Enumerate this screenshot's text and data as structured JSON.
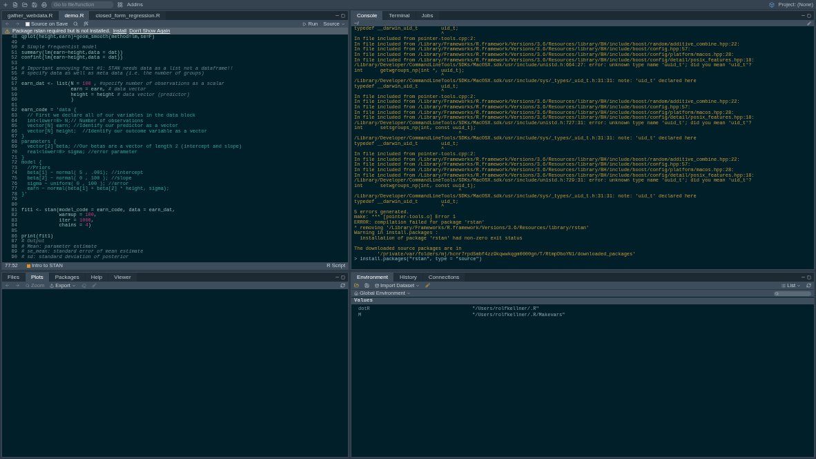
{
  "toolbar": {
    "goto_placeholder": "Go to file/function",
    "addins": "Addins",
    "project": "Project: (None)"
  },
  "editor": {
    "tabs": [
      {
        "label": "gather_webdata.R",
        "selected": false
      },
      {
        "label": "demo.R",
        "selected": true
      },
      {
        "label": "closed_form_regression.R",
        "selected": false
      }
    ],
    "source_on_save": {
      "label": "Source on Save",
      "checked": false
    },
    "run": "Run",
    "source": "Source",
    "warning": {
      "message": "Package rstan required but is not installed.",
      "install": "Install",
      "dismiss": "Don't Show Again"
    },
    "lines": [
      {
        "n": "48",
        "segments": [
          {
            "text": "qplot(height,earn)+geom_smooth(method=lm,se=F)",
            "kind": "code"
          }
        ]
      },
      {
        "n": "49"
      },
      {
        "n": "50",
        "segments": [
          {
            "text": "# Simple frequentist model",
            "kind": "comment"
          }
        ]
      },
      {
        "n": "51",
        "segments": [
          {
            "text": "summary(lm(earn~height,data = dat))",
            "kind": "code"
          }
        ]
      },
      {
        "n": "52",
        "segments": [
          {
            "text": "confint(lm(earn~height,data = dat))",
            "kind": "code"
          }
        ]
      },
      {
        "n": "53"
      },
      {
        "n": "54",
        "segments": [
          {
            "text": "# Important annoying fact #1: STAN needs data as a list not a dataframe!!",
            "kind": "comment"
          }
        ]
      },
      {
        "n": "55",
        "segments": [
          {
            "text": "# specify data as well as meta data (i.e. the number of groups)",
            "kind": "comment"
          }
        ]
      },
      {
        "n": "56"
      },
      {
        "n": "57",
        "segments": [
          {
            "text": "earn_dat <- list(N = ",
            "kind": "code"
          },
          {
            "text": "100",
            "kind": "number"
          },
          {
            "text": " , ",
            "kind": "code"
          },
          {
            "text": "#specify number of observations as a scalar",
            "kind": "comment"
          }
        ]
      },
      {
        "n": "58",
        "segments": [
          {
            "text": "                 earn = earn, ",
            "kind": "code"
          },
          {
            "text": "# data vector",
            "kind": "comment"
          }
        ]
      },
      {
        "n": "59",
        "segments": [
          {
            "text": "                 height = height ",
            "kind": "code"
          },
          {
            "text": "# data vector (predictor)",
            "kind": "comment"
          }
        ]
      },
      {
        "n": "60",
        "segments": [
          {
            "text": "                 )",
            "kind": "code"
          }
        ]
      },
      {
        "n": "61"
      },
      {
        "n": "62",
        "segments": [
          {
            "text": "earn_code = ",
            "kind": "code"
          },
          {
            "text": "'data {",
            "kind": "string"
          }
        ]
      },
      {
        "n": "63",
        "segments": [
          {
            "text": "  // First we declare all of our variables in the data block",
            "kind": "string"
          }
        ]
      },
      {
        "n": "64",
        "segments": [
          {
            "text": "  int<lower=0> N;// Number of observations",
            "kind": "string"
          }
        ]
      },
      {
        "n": "65",
        "segments": [
          {
            "text": "  vector[N] earn; //Identify our predictor as a vector",
            "kind": "string"
          }
        ]
      },
      {
        "n": "66",
        "segments": [
          {
            "text": "  vector[N] height;  //Identify our outcome variable as a vector",
            "kind": "string"
          }
        ]
      },
      {
        "n": "67",
        "segments": [
          {
            "text": "}",
            "kind": "string"
          }
        ]
      },
      {
        "n": "68",
        "segments": [
          {
            "text": "parameters {",
            "kind": "string"
          }
        ]
      },
      {
        "n": "69",
        "segments": [
          {
            "text": "  vector[2] beta; //Our betas are a vector of length 2 (intercept and slope)",
            "kind": "string"
          }
        ]
      },
      {
        "n": "70",
        "segments": [
          {
            "text": "  real<lower=0> sigma; //error parameter",
            "kind": "string"
          }
        ]
      },
      {
        "n": "71",
        "segments": [
          {
            "text": "}",
            "kind": "string"
          }
        ]
      },
      {
        "n": "72",
        "segments": [
          {
            "text": "model {",
            "kind": "string"
          }
        ]
      },
      {
        "n": "73",
        "segments": [
          {
            "text": "  //Priors",
            "kind": "string"
          }
        ]
      },
      {
        "n": "74",
        "segments": [
          {
            "text": "  beta[1] ~ normal( 5 , .001); //intercept",
            "kind": "string"
          }
        ]
      },
      {
        "n": "75",
        "segments": [
          {
            "text": "  beta[2] ~ normal( 0 , 100 ); //slope",
            "kind": "string"
          }
        ]
      },
      {
        "n": "76",
        "segments": [
          {
            "text": "  sigma ~ uniform( 0 , 100 ); //error",
            "kind": "string"
          }
        ]
      },
      {
        "n": "77",
        "segments": [
          {
            "text": "  earn ~ normal(beta[1] + beta[2] * height, sigma);",
            "kind": "string"
          }
        ]
      },
      {
        "n": "78",
        "segments": [
          {
            "text": "}'",
            "kind": "string"
          }
        ]
      },
      {
        "n": "79"
      },
      {
        "n": "80"
      },
      {
        "n": "81",
        "segments": [
          {
            "text": "fit1 <- stan(model_code = earn_code, data = earn_dat,",
            "kind": "code"
          }
        ]
      },
      {
        "n": "82",
        "segments": [
          {
            "text": "             warmup = ",
            "kind": "code"
          },
          {
            "text": "100",
            "kind": "number"
          },
          {
            "text": ",",
            "kind": "code"
          }
        ]
      },
      {
        "n": "83",
        "segments": [
          {
            "text": "             iter = ",
            "kind": "code"
          },
          {
            "text": "1000",
            "kind": "number"
          },
          {
            "text": ",",
            "kind": "code"
          }
        ]
      },
      {
        "n": "84",
        "segments": [
          {
            "text": "             chains = ",
            "kind": "code"
          },
          {
            "text": "4",
            "kind": "number"
          },
          {
            "text": ")",
            "kind": "code"
          }
        ]
      },
      {
        "n": "85"
      },
      {
        "n": "86",
        "segments": [
          {
            "text": "print(fit1)",
            "kind": "code"
          }
        ]
      },
      {
        "n": "87",
        "segments": [
          {
            "text": "# Output",
            "kind": "comment"
          }
        ]
      },
      {
        "n": "88",
        "segments": [
          {
            "text": "# Mean: parameter estimate",
            "kind": "comment"
          }
        ]
      },
      {
        "n": "89",
        "segments": [
          {
            "text": "# se_mean: standard error of mean estimate",
            "kind": "comment"
          }
        ]
      },
      {
        "n": "90",
        "segments": [
          {
            "text": "# sd: standard deviation of posterior",
            "kind": "comment"
          }
        ]
      }
    ],
    "status": {
      "position": "77:52",
      "section": "Intro to STAN",
      "file_type": "R Script"
    }
  },
  "plots": {
    "tabs": [
      {
        "label": "Files",
        "selected": false
      },
      {
        "label": "Plots",
        "selected": true
      },
      {
        "label": "Packages",
        "selected": false
      },
      {
        "label": "Help",
        "selected": false
      },
      {
        "label": "Viewer",
        "selected": false
      }
    ],
    "zoom": {
      "label": "Zoom",
      "disabled": true
    },
    "export": "Export"
  },
  "console": {
    "tabs": [
      {
        "label": "Console",
        "selected": true
      },
      {
        "label": "Terminal",
        "selected": false
      },
      {
        "label": "Jobs",
        "selected": false
      }
    ],
    "path": "~/",
    "lines": [
      {
        "kind": "output",
        "text": "typedef __darwin_uid_t        uid_t;"
      },
      {
        "kind": "output",
        "text": "                              ^"
      },
      {
        "kind": "output",
        "text": "In file included from pointer-tools.cpp:2:"
      },
      {
        "kind": "output",
        "text": "In file included from /Library/Frameworks/R.framework/Versions/3.6/Resources/library/BH/include/boost/random/additive_combine.hpp:22:"
      },
      {
        "kind": "output",
        "text": "In file included from /Library/Frameworks/R.framework/Versions/3.6/Resources/library/BH/include/boost/config.hpp:57:"
      },
      {
        "kind": "output",
        "text": "In file included from /Library/Frameworks/R.framework/Versions/3.6/Resources/library/BH/include/boost/config/platform/macos.hpp:28:"
      },
      {
        "kind": "output",
        "text": "In file included from /Library/Frameworks/R.framework/Versions/3.6/Resources/library/BH/include/boost/config/detail/posix_features.hpp:18:"
      },
      {
        "kind": "output",
        "text": "/Library/Developer/CommandLineTools/SDKs/MacOSX.sdk/usr/include/unistd.h:664:27: error: unknown type name 'uuid_t'; did you mean 'uid_t'?"
      },
      {
        "kind": "output",
        "text": "int      getwgroups_np(int *, uuid_t);"
      },
      {
        "kind": "output",
        "text": "                              ^"
      },
      {
        "kind": "output",
        "text": "/Library/Developer/CommandLineTools/SDKs/MacOSX.sdk/usr/include/sys/_types/_uid_t.h:31:31: note: 'uid_t' declared here"
      },
      {
        "kind": "output",
        "text": "typedef __darwin_uid_t        uid_t;"
      },
      {
        "kind": "output",
        "text": "                              ^"
      },
      {
        "kind": "output",
        "text": "In file included from pointer-tools.cpp:2:"
      },
      {
        "kind": "output",
        "text": "In file included from /Library/Frameworks/R.framework/Versions/3.6/Resources/library/BH/include/boost/random/additive_combine.hpp:22:"
      },
      {
        "kind": "output",
        "text": "In file included from /Library/Frameworks/R.framework/Versions/3.6/Resources/library/BH/include/boost/config.hpp:57:"
      },
      {
        "kind": "output",
        "text": "In file included from /Library/Frameworks/R.framework/Versions/3.6/Resources/library/BH/include/boost/config/platform/macos.hpp:28:"
      },
      {
        "kind": "output",
        "text": "In file included from /Library/Frameworks/R.framework/Versions/3.6/Resources/library/BH/include/boost/config/detail/posix_features.hpp:18:"
      },
      {
        "kind": "output",
        "text": "/Library/Developer/CommandLineTools/SDKs/MacOSX.sdk/usr/include/unistd.h:727:31: error: unknown type name 'uuid_t'; did you mean 'uid_t'?"
      },
      {
        "kind": "output",
        "text": "int      setsgroups_np(int, const uuid_t);"
      },
      {
        "kind": "output",
        "text": "                                    ^"
      },
      {
        "kind": "output",
        "text": "/Library/Developer/CommandLineTools/SDKs/MacOSX.sdk/usr/include/sys/_types/_uid_t.h:31:31: note: 'uid_t' declared here"
      },
      {
        "kind": "output",
        "text": "typedef __darwin_uid_t        uid_t;"
      },
      {
        "kind": "output",
        "text": "                              ^"
      },
      {
        "kind": "output",
        "text": "In file included from pointer-tools.cpp:2:"
      },
      {
        "kind": "output",
        "text": "In file included from /Library/Frameworks/R.framework/Versions/3.6/Resources/library/BH/include/boost/random/additive_combine.hpp:22:"
      },
      {
        "kind": "output",
        "text": "In file included from /Library/Frameworks/R.framework/Versions/3.6/Resources/library/BH/include/boost/config.hpp:57:"
      },
      {
        "kind": "output",
        "text": "In file included from /Library/Frameworks/R.framework/Versions/3.6/Resources/library/BH/include/boost/config/platform/macos.hpp:28:"
      },
      {
        "kind": "output",
        "text": "In file included from /Library/Frameworks/R.framework/Versions/3.6/Resources/library/BH/include/boost/config/detail/posix_features.hpp:18:"
      },
      {
        "kind": "output",
        "text": "/Library/Developer/CommandLineTools/SDKs/MacOSX.sdk/usr/include/unistd.h:729:31: error: unknown type name 'uuid_t'; did you mean 'uid_t'?"
      },
      {
        "kind": "output",
        "text": "int      setwgroups_np(int, const uuid_t);"
      },
      {
        "kind": "output",
        "text": "                                    ^"
      },
      {
        "kind": "output",
        "text": "/Library/Developer/CommandLineTools/SDKs/MacOSX.sdk/usr/include/sys/_types/_uid_t.h:31:31: note: 'uid_t' declared here"
      },
      {
        "kind": "output",
        "text": "typedef __darwin_uid_t        uid_t;"
      },
      {
        "kind": "output",
        "text": "                              ^"
      },
      {
        "kind": "output",
        "text": "5 errors generated."
      },
      {
        "kind": "output",
        "text": "make: *** [pointer-tools.o] Error 1"
      },
      {
        "kind": "output",
        "text": "ERROR: compilation failed for package 'rstan'"
      },
      {
        "kind": "output",
        "text": "* removing '/Library/Frameworks/R.framework/Versions/3.6/Resources/library/rstan'"
      },
      {
        "kind": "output",
        "text": "Warning in install.packages :"
      },
      {
        "kind": "output",
        "text": "  installation of package 'rstan' had non-zero exit status"
      },
      {
        "kind": "blank"
      },
      {
        "kind": "output",
        "text": "The downloaded source packages are in"
      },
      {
        "kind": "output",
        "text": "        '/private/var/folders/mj/hcnr7rpd5mbf4zz9kqwwkqgm0000gn/T/RtmpDboYN1/downloaded_packages'"
      },
      {
        "kind": "prompt",
        "text": "> install.packages(\"rstan\", type = \"source\")"
      }
    ]
  },
  "environment": {
    "tabs": [
      {
        "label": "Environment",
        "selected": true
      },
      {
        "label": "History",
        "selected": false
      },
      {
        "label": "Connections",
        "selected": false
      }
    ],
    "import": "Import Dataset",
    "view": "List",
    "scope": "Global Environment",
    "section": "Values",
    "rows": [
      {
        "name": "dotR",
        "value": "\"/Users/rolfkellner/.R\""
      },
      {
        "name": "M",
        "value": "\"/Users/rolfkellner/.R/Makevars\""
      }
    ]
  }
}
